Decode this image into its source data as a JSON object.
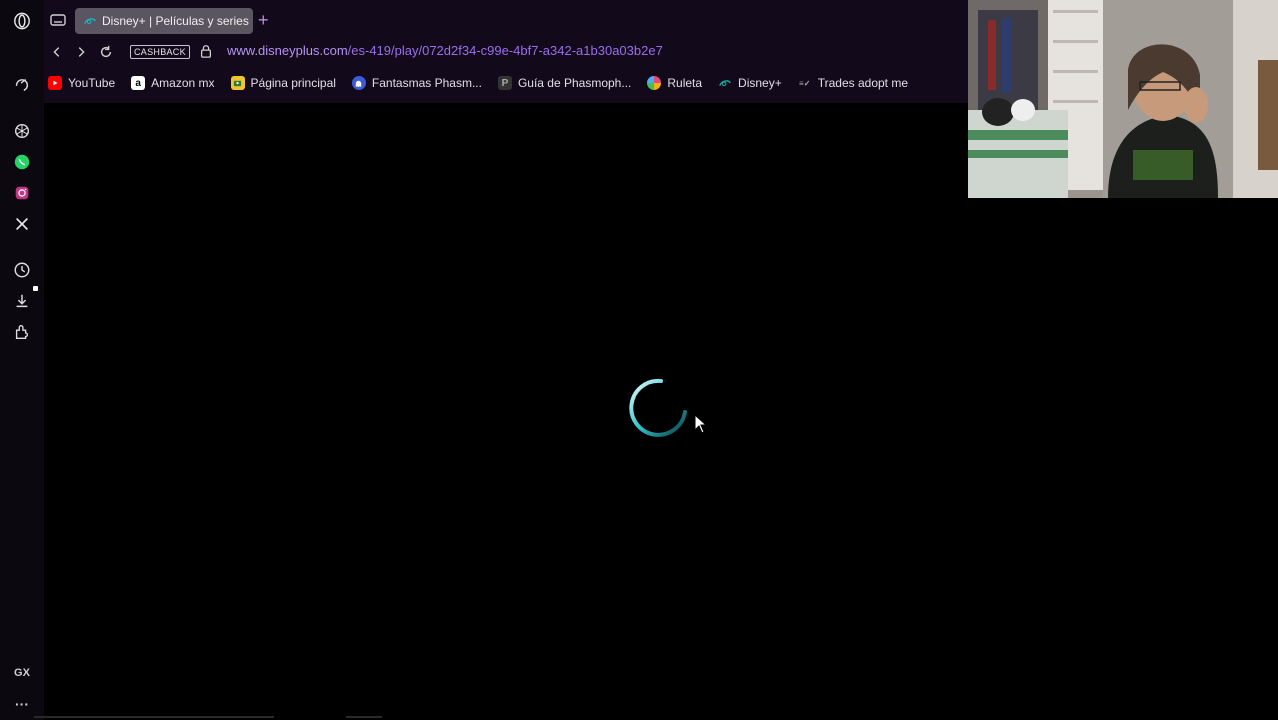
{
  "browser": {
    "tab_title": "Disney+ | Películas y series",
    "new_tab_symbol": "+",
    "cashback_label": "CASHBACK",
    "url_host": "www.disneyplus.com",
    "url_path": "/es-419/play/072d2f34-c99e-4bf7-a342-a1b30a03b2e7"
  },
  "bookmarks": [
    {
      "label": "YouTube",
      "icon": "youtube-icon",
      "color": "#ff0000"
    },
    {
      "label": "Amazon mx",
      "icon": "amazon-icon",
      "color": "#ffffff"
    },
    {
      "label": "Página principal",
      "icon": "classroom-icon",
      "color": "#f4c430"
    },
    {
      "label": "Fantasmas Phasm...",
      "icon": "ghost-icon",
      "color": "#3b5bdb"
    },
    {
      "label": "Guía de Phasmoph...",
      "icon": "phasmo-icon",
      "color": "#444444"
    },
    {
      "label": "Ruleta",
      "icon": "wheel-icon",
      "color": "#e64980"
    },
    {
      "label": "Disney+",
      "icon": "disney-icon",
      "color": "#1aa3a3"
    },
    {
      "label": "Trades adopt me",
      "icon": "adoptme-icon",
      "color": "#999999"
    }
  ],
  "sidebar": {
    "gx_label": "GX",
    "more_label": "···"
  },
  "colors": {
    "accent": "#9d6cf0",
    "spinner": "#2fc4cf",
    "background": "#000000"
  }
}
